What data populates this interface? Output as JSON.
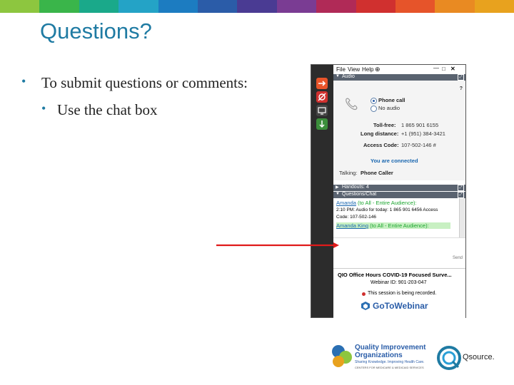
{
  "colors": {
    "top_bar": [
      "#8dc63f",
      "#3ab54a",
      "#1aa98a",
      "#24a3c6",
      "#1c7cc1",
      "#2b5ca8",
      "#4a3b93",
      "#7a3c93",
      "#b02a57",
      "#d0302f",
      "#e6542a",
      "#e98a22",
      "#e8a21e"
    ],
    "title": "#1f7ba3",
    "arrow": "#e01a1a"
  },
  "slide": {
    "title": "Questions?",
    "bullet1": "To submit questions or comments:",
    "bullet2": "Use the chat box"
  },
  "panel": {
    "menu": {
      "file": "File",
      "view": "View",
      "help": "Help"
    },
    "audio": {
      "section_label": "Audio",
      "phone_call": "Phone call",
      "no_audio": "No audio",
      "tollfree_label": "Toll-free:",
      "tollfree_value": "1 865 901 6155",
      "longdistance_label": "Long distance:",
      "longdistance_value": "+1 (951) 384-3421",
      "access_label": "Access Code:",
      "access_value": "107-502-146 #",
      "connected": "You are connected",
      "talking_label": "Talking:",
      "talking_value": "Phone Caller"
    },
    "handouts": "Handouts: 4",
    "chat": {
      "section_label": "Questions/Chat",
      "msg1_name": "Amanda",
      "msg1_to": "(to All - Entire Audience):",
      "msg1_body": "2:10 PM: Audio for today: 1 865 901 6456 Access Code: 107-502-146",
      "msg2_name": "Amanda King",
      "msg2_to": "(to All - Entire Audience):",
      "send": "Send"
    },
    "footer": {
      "webinar_title": "QIO Office Hours COVID-19 Focused Surve...",
      "webinar_id": "Webinar ID: 901-203-047",
      "recording": "This session is being recorded.",
      "brand": "GoToWebinar"
    }
  },
  "logos": {
    "qio_line1": "Quality Improvement",
    "qio_line2": "Organizations",
    "qio_tag": "Sharing Knowledge. Improving Health Care.",
    "qio_sub": "CENTERS FOR MEDICARE & MEDICAID SERVICES",
    "qsource": "Qsource."
  }
}
